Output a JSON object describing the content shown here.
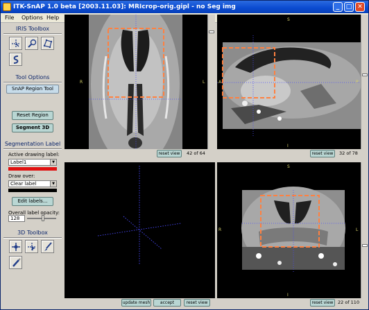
{
  "window": {
    "title": "ITK-SnAP 1.0 beta [2003.11.03]: MRIcrop-orig.gipl - no Seg img"
  },
  "menu": {
    "file": "File",
    "options": "Options",
    "help": "Help"
  },
  "iris_toolbox": {
    "title": "IRIS Toolbox",
    "tools": [
      {
        "icon": "crosshair-cursor-icon"
      },
      {
        "icon": "zoom-icon"
      },
      {
        "icon": "polygon-icon"
      },
      {
        "icon": "snake-icon"
      }
    ]
  },
  "tool_options": {
    "title": "Tool Options",
    "mode_label": "SnAP Region Tool",
    "reset_region": "Reset Region",
    "segment_3d": "Segment 3D"
  },
  "segmentation_label": {
    "title": "Segmentation Label",
    "active_label_caption": "Active drawing label:",
    "active_label_value": "Label1",
    "active_color": "#e01010",
    "draw_over_caption": "Draw over:",
    "draw_over_value": "Clear label",
    "draw_over_color": "#000000",
    "edit_labels": "Edit labels...",
    "opacity_caption": "Overall label opacity:",
    "opacity_value": "128",
    "opacity_fraction": 0.5
  },
  "toolbox_3d": {
    "title": "3D Toolbox",
    "tools": [
      {
        "icon": "3d-crosshair-icon"
      },
      {
        "icon": "3d-cursor-icon"
      },
      {
        "icon": "brush-icon"
      },
      {
        "icon": "scalpel-icon"
      }
    ]
  },
  "views": {
    "axial": {
      "reset": "reset view",
      "counter": "42 of 64",
      "orient_left": "R",
      "orient_right": "L",
      "slider_fraction": 0.12
    },
    "sagittal": {
      "reset": "reset view",
      "counter": "32 of 78",
      "orient_top": "S",
      "orient_bottom": "I",
      "orient_left": "A",
      "orient_right": "P",
      "slider_fraction": 0.45
    },
    "three_d": {
      "update_mesh": "update mesh",
      "accept": "accept",
      "reset": "reset view"
    },
    "coronal": {
      "reset": "reset view",
      "counter": "22 of 110",
      "orient_top": "S",
      "orient_bottom": "I",
      "orient_left": "R",
      "orient_right": "L",
      "slider_fraction": 0.62
    }
  },
  "colors": {
    "roi_box": "#ff8040",
    "crosshair": "#4a4aff",
    "panel_bg": "#000000"
  }
}
